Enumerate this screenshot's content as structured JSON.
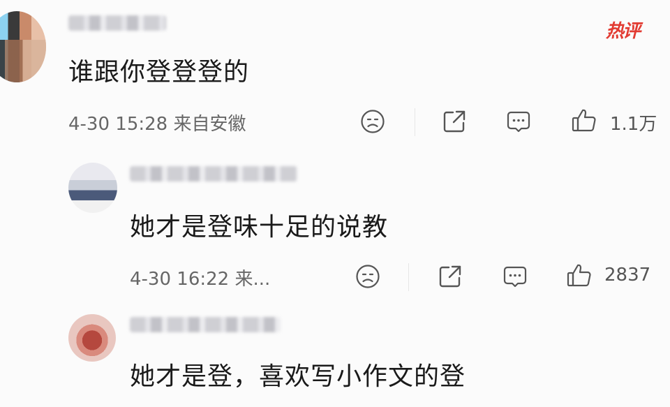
{
  "badge": {
    "label": "热评",
    "color": "#e23b32"
  },
  "comments": [
    {
      "text": "谁跟你登登登的",
      "meta": "4-30 15:28 来自安徽",
      "likes": "1.1万",
      "icons": [
        "dislike-face-icon",
        "share-icon",
        "reply-icon",
        "like-thumb-icon"
      ]
    },
    {
      "text": "她才是登味十足的说教",
      "meta": "4-30 16:22 来...",
      "likes": "2837",
      "icons": [
        "dislike-face-icon",
        "share-icon",
        "reply-icon",
        "like-thumb-icon"
      ]
    },
    {
      "text": "她才是登，喜欢写小作文的登"
    }
  ]
}
